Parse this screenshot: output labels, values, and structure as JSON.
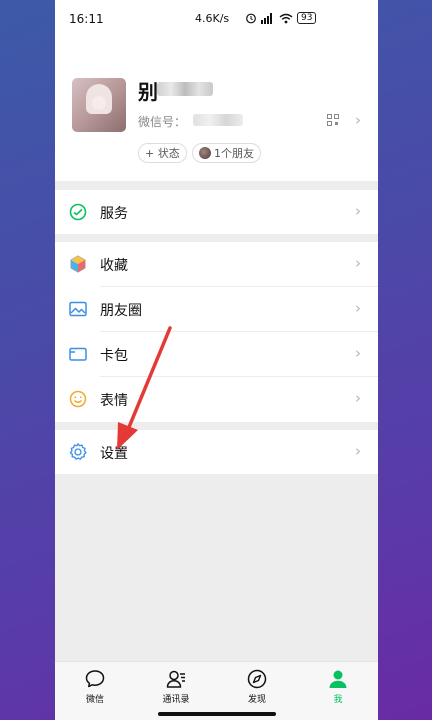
{
  "status_bar": {
    "time": "16:11",
    "network_speed": "4.6K/s",
    "battery": "93"
  },
  "profile": {
    "nickname_visible_char": "别",
    "wechat_id_label": "微信号：",
    "status_pill": "+ 状态",
    "friends_pill": "1个朋友"
  },
  "menu": {
    "services": "服务",
    "favorites": "收藏",
    "moments": "朋友圈",
    "cards": "卡包",
    "stickers": "表情",
    "settings": "设置"
  },
  "tabs": [
    {
      "label": "微信",
      "icon": "chat-bubble-icon",
      "active": false
    },
    {
      "label": "通讯录",
      "icon": "contacts-icon",
      "active": false
    },
    {
      "label": "发现",
      "icon": "compass-icon",
      "active": false
    },
    {
      "label": "我",
      "icon": "person-icon",
      "active": true
    }
  ],
  "colors": {
    "accent": "#07c160",
    "annotation_arrow": "#e53935"
  }
}
